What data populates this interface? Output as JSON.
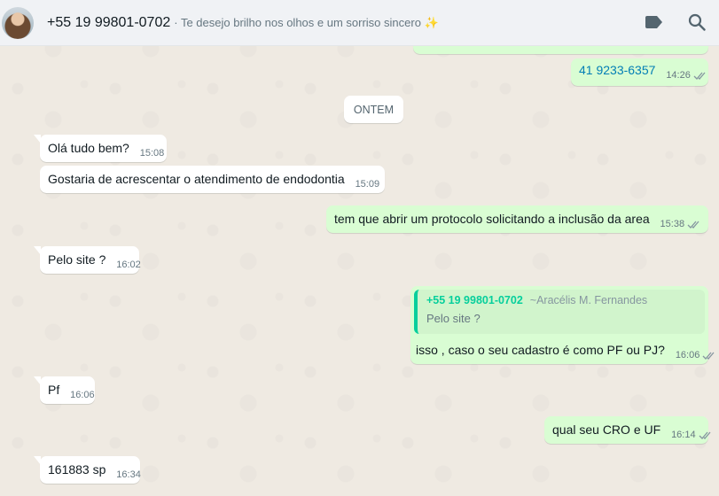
{
  "header": {
    "title": "+55 19 99801-0702",
    "status": "· Te desejo brilho nos olhos e um sorriso sincero ✨",
    "icons": [
      "label-icon",
      "search-icon"
    ]
  },
  "date_separator": "ONTEM",
  "messages": [
    {
      "dir": "out",
      "text": "41 9233-6357",
      "time": "14:26",
      "ticks": "read"
    },
    {
      "dir": "in",
      "text": "Olá tudo bem?",
      "time": "15:08"
    },
    {
      "dir": "in",
      "text": "Gostaria de acrescentar o atendimento de endodontia",
      "time": "15:09"
    },
    {
      "dir": "out",
      "text": "tem que abrir um protocolo solicitando a inclusão da area",
      "time": "15:38",
      "ticks": "read"
    },
    {
      "dir": "in",
      "text": "Pelo site ?",
      "time": "16:02"
    },
    {
      "dir": "out",
      "text": "isso , caso o seu cadastro é como PF ou PJ?",
      "time": "16:06",
      "ticks": "read",
      "quote": {
        "author": "+55 19 99801-0702",
        "pushname": "~Aracélis M. Fernandes",
        "text": "Pelo site ?"
      }
    },
    {
      "dir": "in",
      "text": "Pf",
      "time": "16:06"
    },
    {
      "dir": "out",
      "text": "qual seu CRO e UF",
      "time": "16:14",
      "ticks": "read"
    },
    {
      "dir": "in",
      "text": "161883 sp",
      "time": "16:34"
    }
  ],
  "colors": {
    "incoming": "#ffffff",
    "outgoing": "#d9fdd3",
    "read_tick": "#53bdeb",
    "accent": "#06cf9c",
    "link": "#027eb5"
  }
}
